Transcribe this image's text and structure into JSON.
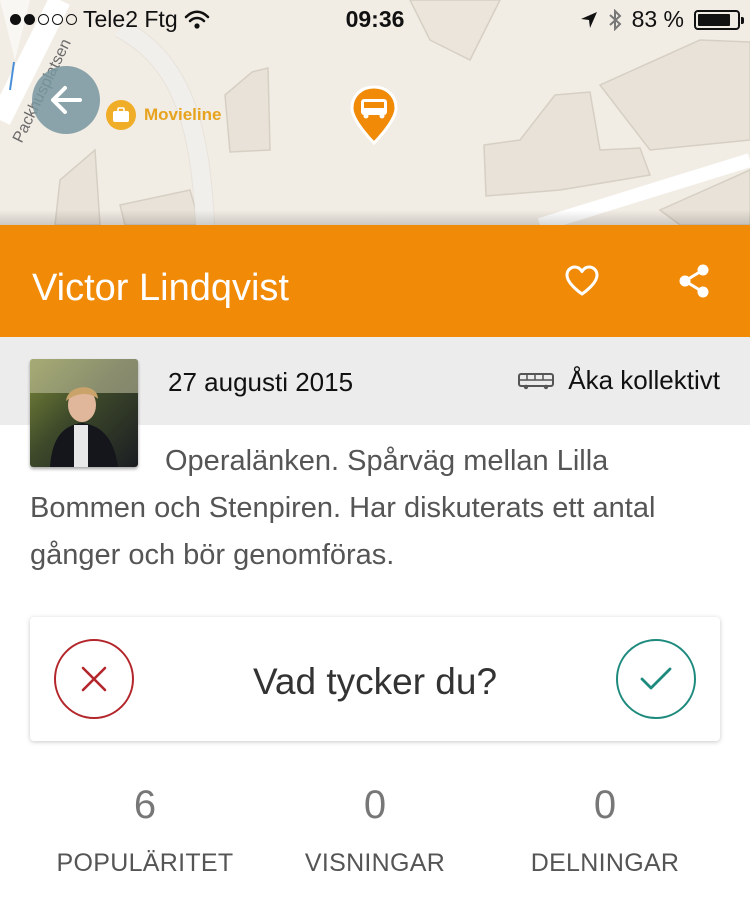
{
  "status_bar": {
    "carrier": "Tele2 Ftg",
    "time": "09:36",
    "battery": "83 %",
    "signal_strength": 2,
    "battery_level": 0.83
  },
  "map": {
    "poi_label": "Movieline",
    "street_label": "Packhusplatsen",
    "marker_icon": "bus-icon"
  },
  "header": {
    "title": "Victor Lindqvist",
    "background_color": "#f08a07"
  },
  "meta": {
    "date": "27 augusti 2015",
    "category": "Åka kollektivt",
    "category_icon": "bus-icon"
  },
  "description": "Operalänken. Spårväg mellan Lilla Bommen och Stenpiren. Har diskuterats ett antal gånger och bör genomföras.",
  "vote": {
    "question": "Vad tycker du?",
    "no_color": "#b3262b",
    "yes_color": "#1e8a7e"
  },
  "stats": [
    {
      "value": "6",
      "label": "POPULÄRITET"
    },
    {
      "value": "0",
      "label": "VISNINGAR"
    },
    {
      "value": "0",
      "label": "DELNINGAR"
    }
  ]
}
